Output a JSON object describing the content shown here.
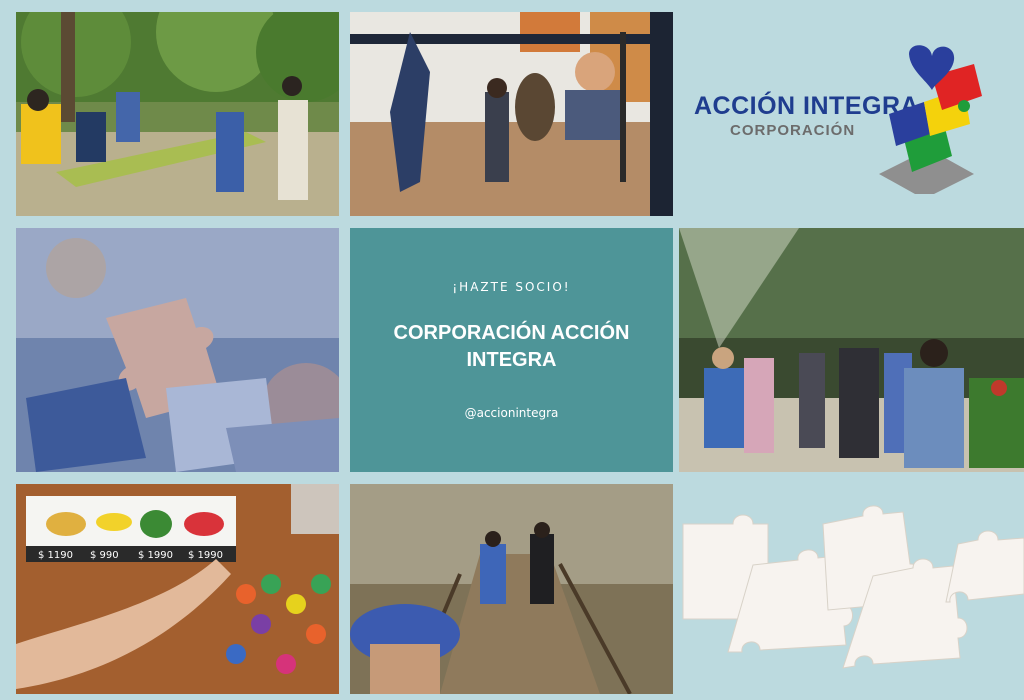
{
  "brand": {
    "name": "ACCIÓN INTEGRA",
    "subtitle": "CORPORACIÓN",
    "colors": {
      "primary": "#1f3d8f",
      "grey": "#6c6c6c",
      "red": "#e02424",
      "yellow": "#f4d20c",
      "green": "#1f9d3a",
      "blue": "#2a3f9d"
    }
  },
  "card": {
    "eyebrow": "¡HAZTE SOCIO!",
    "title": "CORPORACIÓN ACCIÓN INTEGRA",
    "handle": "@accionintegra",
    "background": "#4e9598"
  },
  "photos": {
    "fruit_prices": [
      "$ 1190",
      "$ 990",
      "$ 1990",
      "$ 1990"
    ]
  },
  "icons": [
    "puzzle-piece-icon",
    "jigsaw-heart-logo"
  ]
}
